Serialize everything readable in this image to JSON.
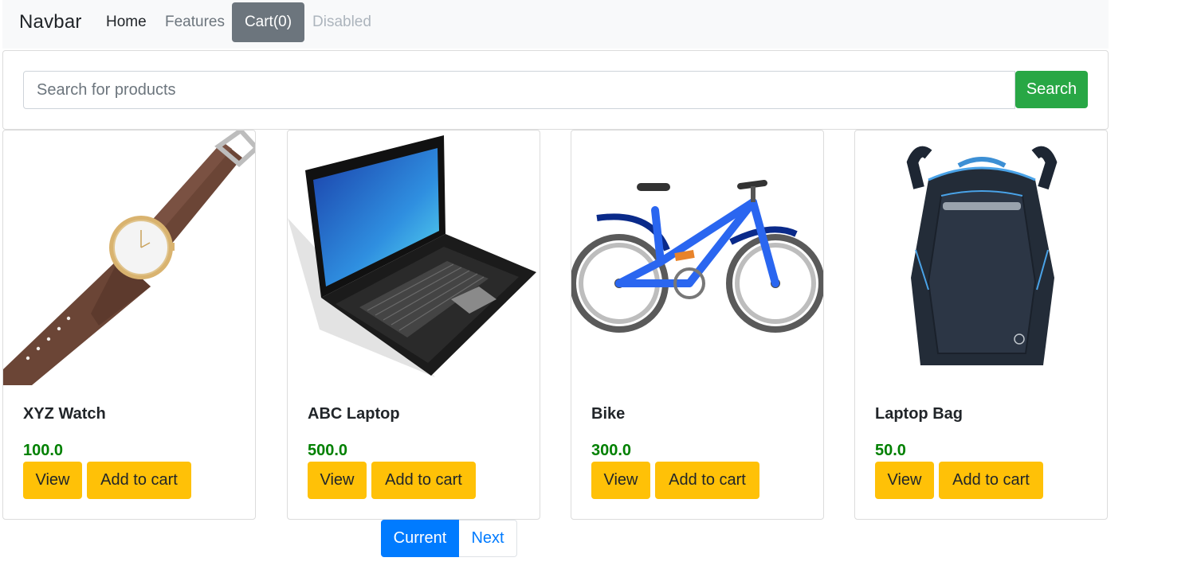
{
  "navbar": {
    "brand": "Navbar",
    "links": {
      "home": "Home",
      "features": "Features",
      "cart": "Cart(0)",
      "disabled": "Disabled"
    }
  },
  "search": {
    "placeholder": "Search for products",
    "value": "",
    "button_label": "Search"
  },
  "products": [
    {
      "name": "XYZ Watch",
      "price": "100.0",
      "image": "watch-image",
      "view_label": "View",
      "cart_label": "Add to cart"
    },
    {
      "name": "ABC Laptop",
      "price": "500.0",
      "image": "laptop-image",
      "view_label": "View",
      "cart_label": "Add to cart"
    },
    {
      "name": "Bike",
      "price": "300.0",
      "image": "bike-image",
      "view_label": "View",
      "cart_label": "Add to cart"
    },
    {
      "name": "Laptop Bag",
      "price": "50.0",
      "image": "backpack-image",
      "view_label": "View",
      "cart_label": "Add to cart"
    }
  ],
  "pagination": {
    "current": "Current",
    "next": "Next"
  },
  "colors": {
    "navbar_bg": "#f8f9fa",
    "cart_bg": "#6c757d",
    "search_button": "#28a745",
    "price": "#008000",
    "action_button": "#ffc107",
    "pagination_active": "#007bff"
  }
}
